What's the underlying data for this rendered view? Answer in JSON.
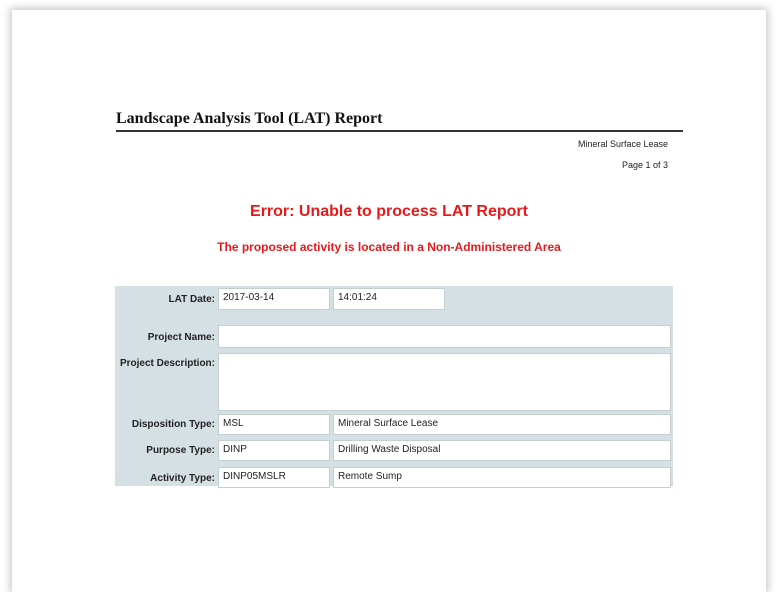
{
  "report": {
    "title": "Landscape Analysis Tool (LAT) Report",
    "disposition_name": "Mineral Surface Lease",
    "page_label": "Page 1 of 3",
    "error_title": "Error: Unable to process LAT Report",
    "error_subtitle": "The proposed activity is located in a Non-Administered Area"
  },
  "form": {
    "lat_date": {
      "label": "LAT Date:",
      "date": "2017-03-14",
      "time": "14:01:24"
    },
    "project_name": {
      "label": "Project Name:",
      "value": ""
    },
    "project_description": {
      "label": "Project Description:",
      "value": ""
    },
    "disposition_type": {
      "label": "Disposition Type:",
      "code": "MSL",
      "description": "Mineral Surface Lease"
    },
    "purpose_type": {
      "label": "Purpose Type:",
      "code": "DINP",
      "description": "Drilling Waste Disposal"
    },
    "activity_type": {
      "label": "Activity Type:",
      "code": "DINP05MSLR",
      "description": "Remote Sump"
    }
  }
}
